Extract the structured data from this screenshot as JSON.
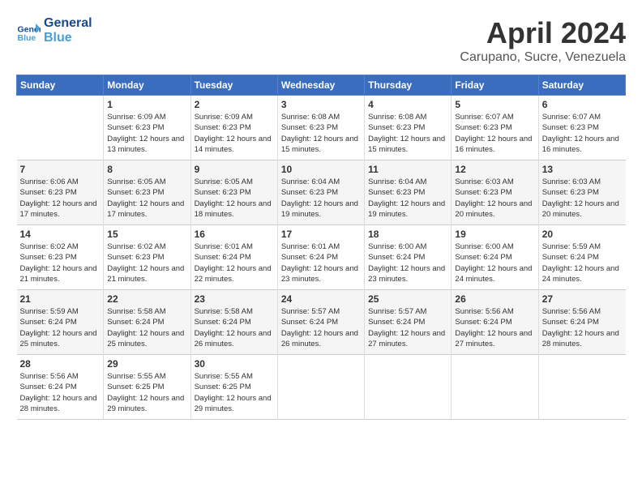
{
  "header": {
    "logo_general": "General",
    "logo_blue": "Blue",
    "month_title": "April 2024",
    "location": "Carupano, Sucre, Venezuela"
  },
  "days_of_week": [
    "Sunday",
    "Monday",
    "Tuesday",
    "Wednesday",
    "Thursday",
    "Friday",
    "Saturday"
  ],
  "weeks": [
    [
      {
        "day": "",
        "info": ""
      },
      {
        "day": "1",
        "info": "Sunrise: 6:09 AM\nSunset: 6:23 PM\nDaylight: 12 hours\nand 13 minutes."
      },
      {
        "day": "2",
        "info": "Sunrise: 6:09 AM\nSunset: 6:23 PM\nDaylight: 12 hours\nand 14 minutes."
      },
      {
        "day": "3",
        "info": "Sunrise: 6:08 AM\nSunset: 6:23 PM\nDaylight: 12 hours\nand 15 minutes."
      },
      {
        "day": "4",
        "info": "Sunrise: 6:08 AM\nSunset: 6:23 PM\nDaylight: 12 hours\nand 15 minutes."
      },
      {
        "day": "5",
        "info": "Sunrise: 6:07 AM\nSunset: 6:23 PM\nDaylight: 12 hours\nand 16 minutes."
      },
      {
        "day": "6",
        "info": "Sunrise: 6:07 AM\nSunset: 6:23 PM\nDaylight: 12 hours\nand 16 minutes."
      }
    ],
    [
      {
        "day": "7",
        "info": "Sunrise: 6:06 AM\nSunset: 6:23 PM\nDaylight: 12 hours\nand 17 minutes."
      },
      {
        "day": "8",
        "info": "Sunrise: 6:05 AM\nSunset: 6:23 PM\nDaylight: 12 hours\nand 17 minutes."
      },
      {
        "day": "9",
        "info": "Sunrise: 6:05 AM\nSunset: 6:23 PM\nDaylight: 12 hours\nand 18 minutes."
      },
      {
        "day": "10",
        "info": "Sunrise: 6:04 AM\nSunset: 6:23 PM\nDaylight: 12 hours\nand 19 minutes."
      },
      {
        "day": "11",
        "info": "Sunrise: 6:04 AM\nSunset: 6:23 PM\nDaylight: 12 hours\nand 19 minutes."
      },
      {
        "day": "12",
        "info": "Sunrise: 6:03 AM\nSunset: 6:23 PM\nDaylight: 12 hours\nand 20 minutes."
      },
      {
        "day": "13",
        "info": "Sunrise: 6:03 AM\nSunset: 6:23 PM\nDaylight: 12 hours\nand 20 minutes."
      }
    ],
    [
      {
        "day": "14",
        "info": "Sunrise: 6:02 AM\nSunset: 6:23 PM\nDaylight: 12 hours\nand 21 minutes."
      },
      {
        "day": "15",
        "info": "Sunrise: 6:02 AM\nSunset: 6:23 PM\nDaylight: 12 hours\nand 21 minutes."
      },
      {
        "day": "16",
        "info": "Sunrise: 6:01 AM\nSunset: 6:24 PM\nDaylight: 12 hours\nand 22 minutes."
      },
      {
        "day": "17",
        "info": "Sunrise: 6:01 AM\nSunset: 6:24 PM\nDaylight: 12 hours\nand 23 minutes."
      },
      {
        "day": "18",
        "info": "Sunrise: 6:00 AM\nSunset: 6:24 PM\nDaylight: 12 hours\nand 23 minutes."
      },
      {
        "day": "19",
        "info": "Sunrise: 6:00 AM\nSunset: 6:24 PM\nDaylight: 12 hours\nand 24 minutes."
      },
      {
        "day": "20",
        "info": "Sunrise: 5:59 AM\nSunset: 6:24 PM\nDaylight: 12 hours\nand 24 minutes."
      }
    ],
    [
      {
        "day": "21",
        "info": "Sunrise: 5:59 AM\nSunset: 6:24 PM\nDaylight: 12 hours\nand 25 minutes."
      },
      {
        "day": "22",
        "info": "Sunrise: 5:58 AM\nSunset: 6:24 PM\nDaylight: 12 hours\nand 25 minutes."
      },
      {
        "day": "23",
        "info": "Sunrise: 5:58 AM\nSunset: 6:24 PM\nDaylight: 12 hours\nand 26 minutes."
      },
      {
        "day": "24",
        "info": "Sunrise: 5:57 AM\nSunset: 6:24 PM\nDaylight: 12 hours\nand 26 minutes."
      },
      {
        "day": "25",
        "info": "Sunrise: 5:57 AM\nSunset: 6:24 PM\nDaylight: 12 hours\nand 27 minutes."
      },
      {
        "day": "26",
        "info": "Sunrise: 5:56 AM\nSunset: 6:24 PM\nDaylight: 12 hours\nand 27 minutes."
      },
      {
        "day": "27",
        "info": "Sunrise: 5:56 AM\nSunset: 6:24 PM\nDaylight: 12 hours\nand 28 minutes."
      }
    ],
    [
      {
        "day": "28",
        "info": "Sunrise: 5:56 AM\nSunset: 6:24 PM\nDaylight: 12 hours\nand 28 minutes."
      },
      {
        "day": "29",
        "info": "Sunrise: 5:55 AM\nSunset: 6:25 PM\nDaylight: 12 hours\nand 29 minutes."
      },
      {
        "day": "30",
        "info": "Sunrise: 5:55 AM\nSunset: 6:25 PM\nDaylight: 12 hours\nand 29 minutes."
      },
      {
        "day": "",
        "info": ""
      },
      {
        "day": "",
        "info": ""
      },
      {
        "day": "",
        "info": ""
      },
      {
        "day": "",
        "info": ""
      }
    ]
  ]
}
